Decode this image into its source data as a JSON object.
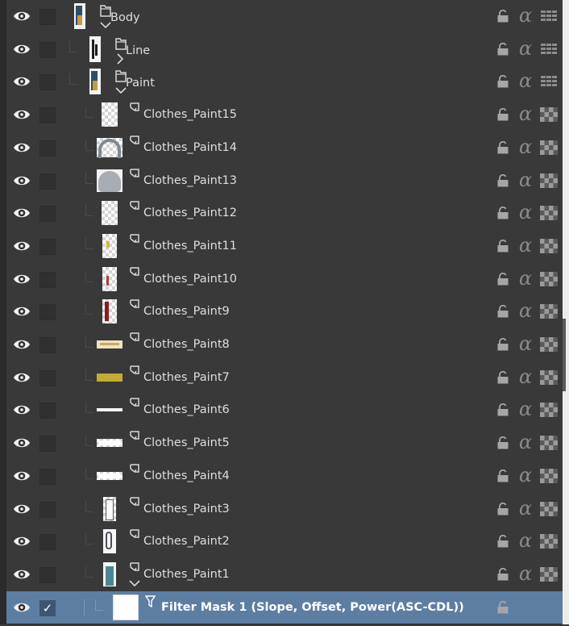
{
  "colors": {
    "panel_bg": "#393939",
    "selected_bg": "#5d7ea3",
    "text": "#dedede",
    "icon": "#8a8a8a"
  },
  "rows": [
    {
      "name": "Body",
      "kind": "folder",
      "expanded": true,
      "depth": 0,
      "checked": false,
      "visible": true,
      "thumb_icon": "figure-thumbnail",
      "blend_icon": "normal-blend-icon"
    },
    {
      "name": "Line",
      "kind": "folder",
      "expanded": false,
      "depth": 1,
      "checked": false,
      "visible": true,
      "thumb_icon": "lineart-thumbnail",
      "blend_icon": "normal-blend-icon"
    },
    {
      "name": "Paint",
      "kind": "folder",
      "expanded": true,
      "depth": 1,
      "checked": false,
      "visible": true,
      "thumb_icon": "figure-thumbnail",
      "blend_icon": "normal-blend-icon"
    },
    {
      "name": "Clothes_Paint15",
      "kind": "layer",
      "depth": 2,
      "checked": false,
      "visible": true,
      "thumb_icon": "transparent-thumbnail",
      "blend_icon": "checker-blend-icon"
    },
    {
      "name": "Clothes_Paint14",
      "kind": "layer",
      "depth": 2,
      "checked": false,
      "visible": true,
      "thumb_icon": "arc-thumbnail",
      "blend_icon": "checker-blend-icon"
    },
    {
      "name": "Clothes_Paint13",
      "kind": "layer",
      "depth": 2,
      "checked": false,
      "visible": true,
      "thumb_icon": "grey-blob-thumbnail",
      "blend_icon": "checker-blend-icon"
    },
    {
      "name": "Clothes_Paint12",
      "kind": "layer",
      "depth": 2,
      "checked": false,
      "visible": true,
      "thumb_icon": "transparent-thumbnail",
      "blend_icon": "checker-blend-icon"
    },
    {
      "name": "Clothes_Paint11",
      "kind": "layer",
      "depth": 2,
      "checked": false,
      "visible": true,
      "thumb_icon": "yellow-speck-thumbnail",
      "blend_icon": "checker-blend-icon"
    },
    {
      "name": "Clothes_Paint10",
      "kind": "layer",
      "depth": 2,
      "checked": false,
      "visible": true,
      "thumb_icon": "red-speck-thumbnail",
      "blend_icon": "checker-blend-icon"
    },
    {
      "name": "Clothes_Paint9",
      "kind": "layer",
      "depth": 2,
      "checked": false,
      "visible": true,
      "thumb_icon": "red-stroke-thumbnail",
      "blend_icon": "checker-blend-icon"
    },
    {
      "name": "Clothes_Paint8",
      "kind": "layer",
      "depth": 2,
      "checked": false,
      "visible": true,
      "thumb_icon": "wide-pale-thumbnail",
      "blend_icon": "checker-blend-icon"
    },
    {
      "name": "Clothes_Paint7",
      "kind": "layer",
      "depth": 2,
      "checked": false,
      "visible": true,
      "thumb_icon": "wide-olive-thumbnail",
      "blend_icon": "checker-blend-icon"
    },
    {
      "name": "Clothes_Paint6",
      "kind": "layer",
      "depth": 2,
      "checked": false,
      "visible": true,
      "thumb_icon": "wide-line-thumbnail",
      "blend_icon": "checker-blend-icon"
    },
    {
      "name": "Clothes_Paint5",
      "kind": "layer",
      "depth": 2,
      "checked": false,
      "visible": true,
      "thumb_icon": "wide-white-thumbnail",
      "blend_icon": "checker-blend-icon"
    },
    {
      "name": "Clothes_Paint4",
      "kind": "layer",
      "depth": 2,
      "checked": false,
      "visible": true,
      "thumb_icon": "wide-white-thumbnail",
      "blend_icon": "checker-blend-icon"
    },
    {
      "name": "Clothes_Paint3",
      "kind": "layer",
      "depth": 2,
      "checked": false,
      "visible": true,
      "thumb_icon": "white-stroke-thumbnail",
      "blend_icon": "checker-blend-icon"
    },
    {
      "name": "Clothes_Paint2",
      "kind": "layer",
      "depth": 2,
      "checked": false,
      "visible": true,
      "thumb_icon": "outline-thumbnail",
      "blend_icon": "checker-blend-icon"
    },
    {
      "name": "Clothes_Paint1",
      "kind": "layer",
      "expanded": true,
      "depth": 2,
      "checked": false,
      "visible": true,
      "thumb_icon": "teal-thumbnail",
      "blend_icon": "checker-blend-icon"
    },
    {
      "name": "Filter Mask 1 (Slope, Offset, Power(ASC-CDL))",
      "kind": "filter-mask",
      "depth": 3,
      "checked": true,
      "visible": true,
      "selected": true,
      "thumb_icon": "white-mask-thumbnail",
      "blend_icon": ""
    }
  ]
}
